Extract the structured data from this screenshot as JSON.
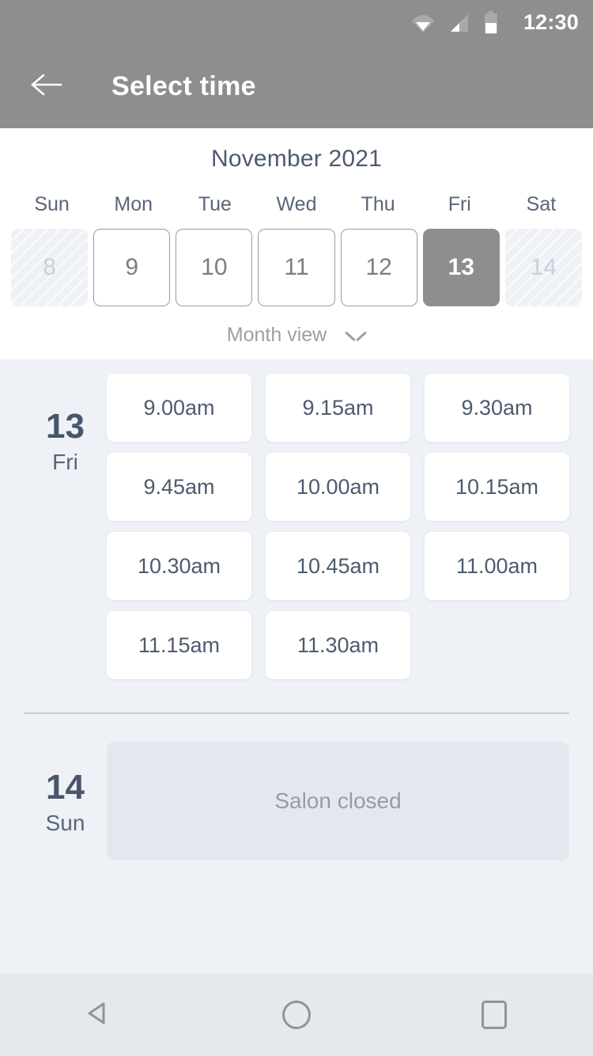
{
  "status_bar": {
    "time": "12:30",
    "icons": [
      "wifi-icon",
      "cellular-signal-icon",
      "battery-icon"
    ]
  },
  "app_bar": {
    "back_icon": "arrow-left-icon",
    "title": "Select time"
  },
  "calendar": {
    "month_title": "November 2021",
    "day_of_week_headers": [
      "Sun",
      "Mon",
      "Tue",
      "Wed",
      "Thu",
      "Fri",
      "Sat"
    ],
    "days": [
      {
        "number": "8",
        "state": "disabled"
      },
      {
        "number": "9",
        "state": "normal"
      },
      {
        "number": "10",
        "state": "normal"
      },
      {
        "number": "11",
        "state": "normal"
      },
      {
        "number": "12",
        "state": "normal"
      },
      {
        "number": "13",
        "state": "selected"
      },
      {
        "number": "14",
        "state": "disabled"
      }
    ],
    "view_toggle": {
      "label": "Month view",
      "icon": "chevron-down-icon"
    }
  },
  "schedule": {
    "days": [
      {
        "day_number": "13",
        "day_of_week": "Fri",
        "slots": [
          "9.00am",
          "9.15am",
          "9.30am",
          "9.45am",
          "10.00am",
          "10.15am",
          "10.30am",
          "10.45am",
          "11.00am",
          "11.15am",
          "11.30am"
        ]
      },
      {
        "day_number": "14",
        "day_of_week": "Sun",
        "closed_label": "Salon closed"
      }
    ]
  },
  "nav_bar": {
    "back_icon": "nav-back-triangle-icon",
    "home_icon": "nav-home-circle-icon",
    "recents_icon": "nav-recents-square-icon"
  },
  "colors": {
    "app_bar_bg": "#8e8e8e",
    "page_bg": "#eef1f6",
    "card_bg": "#ffffff",
    "text_primary": "#4e5a6e",
    "text_muted": "#929cae",
    "selected_day_bg": "#8e8e8e",
    "closed_block_bg": "#e4e8ee",
    "nav_bar_bg": "#e5e8ec"
  }
}
